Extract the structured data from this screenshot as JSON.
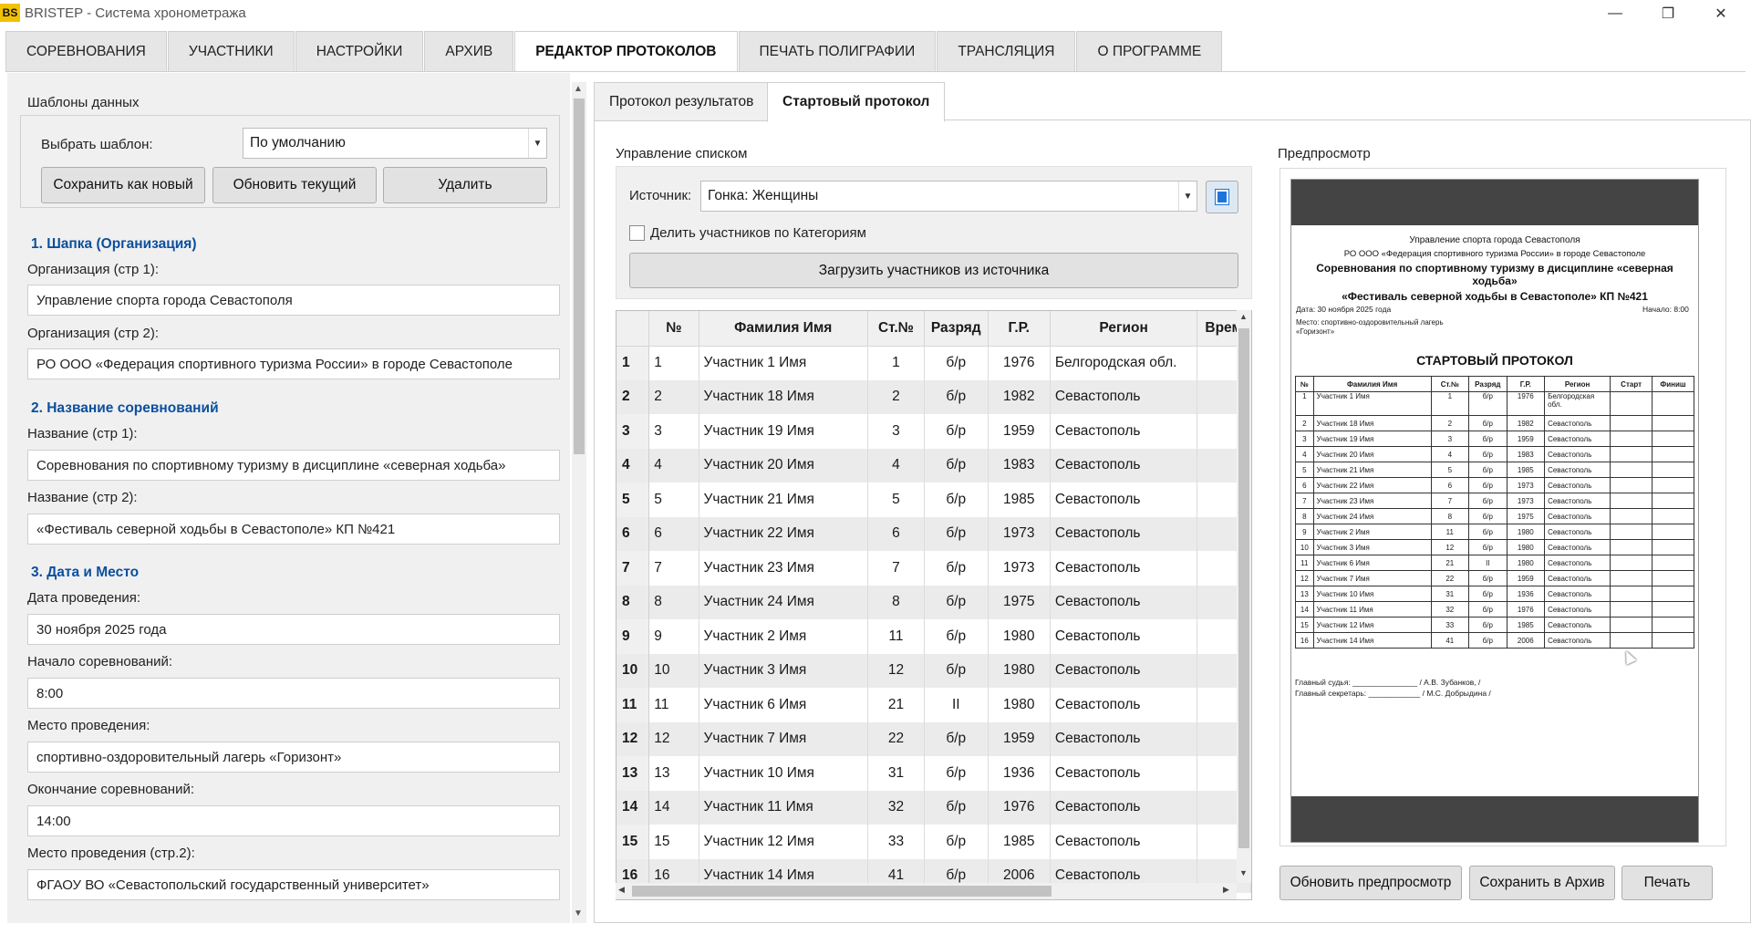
{
  "window": {
    "logo": "BS",
    "title": "BRISTEP - Система хронометража",
    "min": "—",
    "max": "❐",
    "close": "✕"
  },
  "tabs": [
    {
      "label": "СОРЕВНОВАНИЯ"
    },
    {
      "label": "УЧАСТНИКИ"
    },
    {
      "label": "НАСТРОЙКИ"
    },
    {
      "label": "АРХИВ"
    },
    {
      "label": "РЕДАКТОР ПРОТОКОЛОВ",
      "active": true
    },
    {
      "label": "ПЕЧАТЬ ПОЛИГРАФИИ"
    },
    {
      "label": "ТРАНСЛЯЦИЯ"
    },
    {
      "label": "О ПРОГРАММЕ"
    }
  ],
  "left": {
    "templates": {
      "title": "Шаблоны данных",
      "choose_label": "Выбрать шаблон:",
      "choose_value": "По умолчанию",
      "save_new": "Сохранить как новый",
      "update": "Обновить текущий",
      "delete": "Удалить"
    },
    "s1": {
      "header": "1. Шапка (Организация)",
      "org1_label": "Организация (стр 1):",
      "org1": "Управление спорта города Севастополя",
      "org2_label": "Организация (стр 2):",
      "org2": "РО ООО «Федерация спортивного туризма России» в городе Севастополе"
    },
    "s2": {
      "header": "2. Название соревнований",
      "name1_label": "Название (стр 1):",
      "name1": "Соревнования по спортивному туризму в дисциплине «северная ходьба»",
      "name2_label": "Название (стр 2):",
      "name2": "«Фестиваль северной ходьбы в Севастополе»  КП №421"
    },
    "s3": {
      "header": "3. Дата и Место",
      "date_label": "Дата проведения:",
      "date": "30 ноября 2025 года",
      "start_label": "Начало соревнований:",
      "start": "8:00",
      "place_label": "Место проведения:",
      "place": "спортивно-оздоровительный лагерь «Горизонт»",
      "end_label": "Окончание соревнований:",
      "end": "14:00",
      "place2_label": "Место проведения (стр.2):",
      "place2": "ФГАОУ ВО «Севастопольский государственный университет»"
    }
  },
  "subtabs": [
    {
      "label": "Протокол результатов"
    },
    {
      "label": "Стартовый протокол",
      "active": true
    }
  ],
  "list": {
    "title": "Управление списком",
    "source_label": "Источник:",
    "source_value": "Гонка: Женщины",
    "split_label": "Делить участников по Категориям",
    "load_button": "Загрузить участников из источника"
  },
  "grid": {
    "columns": [
      "№",
      "Фамилия Имя",
      "Ст.№",
      "Разряд",
      "Г.Р.",
      "Регион",
      "Время"
    ],
    "rows": [
      {
        "rh": "1",
        "n": "1",
        "name": "Участник 1 Имя",
        "bib": "1",
        "rank": "б/р",
        "year": "1976",
        "region": "Белгородская обл."
      },
      {
        "rh": "2",
        "n": "2",
        "name": "Участник 18 Имя",
        "bib": "2",
        "rank": "б/р",
        "year": "1982",
        "region": "Севастополь"
      },
      {
        "rh": "3",
        "n": "3",
        "name": "Участник 19 Имя",
        "bib": "3",
        "rank": "б/р",
        "year": "1959",
        "region": "Севастополь"
      },
      {
        "rh": "4",
        "n": "4",
        "name": "Участник 20 Имя",
        "bib": "4",
        "rank": "б/р",
        "year": "1983",
        "region": "Севастополь"
      },
      {
        "rh": "5",
        "n": "5",
        "name": "Участник 21 Имя",
        "bib": "5",
        "rank": "б/р",
        "year": "1985",
        "region": "Севастополь"
      },
      {
        "rh": "6",
        "n": "6",
        "name": "Участник 22 Имя",
        "bib": "6",
        "rank": "б/р",
        "year": "1973",
        "region": "Севастополь"
      },
      {
        "rh": "7",
        "n": "7",
        "name": "Участник 23 Имя",
        "bib": "7",
        "rank": "б/р",
        "year": "1973",
        "region": "Севастополь"
      },
      {
        "rh": "8",
        "n": "8",
        "name": "Участник 24 Имя",
        "bib": "8",
        "rank": "б/р",
        "year": "1975",
        "region": "Севастополь"
      },
      {
        "rh": "9",
        "n": "9",
        "name": "Участник 2 Имя",
        "bib": "11",
        "rank": "б/р",
        "year": "1980",
        "region": "Севастополь"
      },
      {
        "rh": "10",
        "n": "10",
        "name": "Участник 3 Имя",
        "bib": "12",
        "rank": "б/р",
        "year": "1980",
        "region": "Севастополь"
      },
      {
        "rh": "11",
        "n": "11",
        "name": "Участник 6 Имя",
        "bib": "21",
        "rank": "II",
        "year": "1980",
        "region": "Севастополь"
      },
      {
        "rh": "12",
        "n": "12",
        "name": "Участник 7 Имя",
        "bib": "22",
        "rank": "б/р",
        "year": "1959",
        "region": "Севастополь"
      },
      {
        "rh": "13",
        "n": "13",
        "name": "Участник 10 Имя",
        "bib": "31",
        "rank": "б/р",
        "year": "1936",
        "region": "Севастополь"
      },
      {
        "rh": "14",
        "n": "14",
        "name": "Участник 11 Имя",
        "bib": "32",
        "rank": "б/р",
        "year": "1976",
        "region": "Севастополь"
      },
      {
        "rh": "15",
        "n": "15",
        "name": "Участник 12 Имя",
        "bib": "33",
        "rank": "б/р",
        "year": "1985",
        "region": "Севастополь"
      },
      {
        "rh": "16",
        "n": "16",
        "name": "Участник 14 Имя",
        "bib": "41",
        "rank": "б/р",
        "year": "2006",
        "region": "Севастополь"
      }
    ]
  },
  "preview": {
    "title": "Предпросмотр",
    "doc": {
      "org1": "Управление спорта города Севастополя",
      "org2": "РО ООО «Федерация спортивного туризма России» в городе Севастополе",
      "name1": "Соревнования по спортивному туризму в дисциплине «северная ходьба»",
      "name2": "«Фестиваль северной ходьбы в Севастополе» КП №421",
      "date": "Дата: 30 ноября 2025 года",
      "start": "Начало: 8:00",
      "place_line1": "Место: спортивно-оздоровительный лагерь",
      "place_line2": "«Горизонт»",
      "heading": "СТАРТОВЫЙ ПРОТОКОЛ",
      "columns": [
        "№",
        "Фамилия Имя",
        "Ст.№",
        "Разряд",
        "Г.Р.",
        "Регион",
        "Старт",
        "Финиш"
      ],
      "region_line1": "Белгородская",
      "region_line2": "обл.",
      "judge": "Главный судья: _______________ / А.В. Зубанков, /",
      "secretary": "Главный секретарь: ____________ / М.С. Добрыдина /"
    },
    "refresh": "Обновить предпросмотр",
    "archive": "Сохранить в Архив",
    "print": "Печать"
  }
}
